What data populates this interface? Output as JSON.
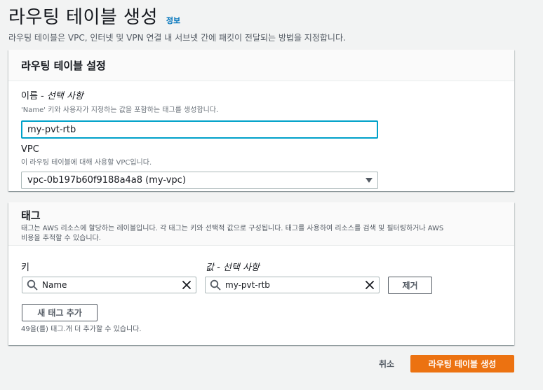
{
  "header": {
    "title": "라우팅 테이블 생성",
    "info_link": "정보",
    "description": "라우팅 테이블은 VPC, 인터넷 및 VPN 연결 내 서브넷 간에 패킷이 전달되는 방법을 지정합니다."
  },
  "settings": {
    "title": "라우팅 테이블 설정",
    "name_label": "이름 - ",
    "name_optional": "선택 사항",
    "name_desc": "'Name' 키와 사용자가 지정하는 값을 포함하는 태그를 생성합니다.",
    "name_value": "my-pvt-rtb",
    "vpc_label": "VPC",
    "vpc_desc": "이 라우팅 테이블에 대해 사용할 VPC입니다.",
    "vpc_value": "vpc-0b197b60f9188a4a8 (my-vpc)"
  },
  "tags": {
    "title": "태그",
    "description_line1": "태그는 AWS 리소스에 할당하는 레이블입니다. 각 태그는 키와 선택적 값으로 구성됩니다. 태그를 사용하여 리소스를 검색 및 필터링하거나 AWS",
    "description_line2": "비용을 추적할 수 있습니다.",
    "key_label": "키",
    "value_label": "값 - ",
    "value_optional": "선택 사항",
    "key_value": "Name",
    "value_value": "my-pvt-rtb",
    "remove_label": "제거",
    "add_label": "새 태그 추가",
    "hint": "49을(를) 태그.개 더 추가할 수 있습니다."
  },
  "footer": {
    "cancel_label": "취소",
    "create_label": "라우팅 테이블 생성"
  },
  "colors": {
    "primary": "#ec7211",
    "focus": "#00a1c9",
    "link": "#0073bb"
  },
  "icons": [
    "search-icon",
    "clear-icon",
    "chevron-down-icon"
  ]
}
